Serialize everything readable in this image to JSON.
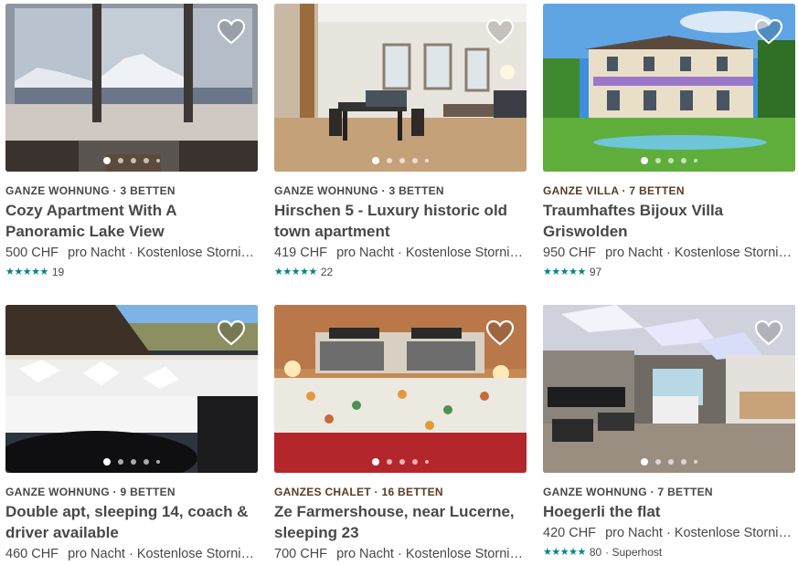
{
  "colors": {
    "text": "#484848",
    "star": "#008489",
    "kicker_brown": "#593c21"
  },
  "listings": [
    {
      "kicker": "GANZE WOHNUNG · 3 BETTEN",
      "title": "Cozy Apartment With A Panoramic Lake View",
      "price": "500 CHF",
      "per_night": "pro Nacht",
      "extra": "· Kostenlose Stornierung",
      "stars": "★★★★★",
      "reviews": "19",
      "superhost": "",
      "icon": "heart-icon"
    },
    {
      "kicker": "GANZE WOHNUNG · 3 BETTEN",
      "title": "Hirschen 5 - Luxury historic old town apartment",
      "price": "419 CHF",
      "per_night": "pro Nacht",
      "extra": "· Kostenlose Stornierung",
      "stars": "★★★★★",
      "reviews": "22",
      "superhost": "",
      "icon": "heart-icon"
    },
    {
      "kicker": "GANZE VILLA · 7 BETTEN",
      "title": "Traumhaftes Bijoux Villa Griswolden",
      "price": "950 CHF",
      "per_night": "pro Nacht",
      "extra": "· Kostenlose Stornierung",
      "stars": "★★★★★",
      "reviews": "97",
      "superhost": "",
      "icon": "heart-icon"
    },
    {
      "kicker": "GANZE WOHNUNG · 9 BETTEN",
      "title": "Double apt, sleeping 14, coach & driver available",
      "price": "460 CHF",
      "per_night": "pro Nacht",
      "extra": "· Kostenlose Stornierung",
      "stars": "",
      "reviews": "",
      "superhost": "",
      "icon": "heart-icon"
    },
    {
      "kicker": "GANZES CHALET · 16 BETTEN",
      "title": "Ze Farmershouse, near Lucerne, sleeping 23",
      "price": "700 CHF",
      "per_night": "pro Nacht",
      "extra": "· Kostenlose Stornierung",
      "stars": "",
      "reviews": "",
      "superhost": "",
      "icon": "heart-icon"
    },
    {
      "kicker": "GANZE WOHNUNG · 7 BETTEN",
      "title": "Hoegerli the flat",
      "price": "420 CHF",
      "per_night": "pro Nacht",
      "extra": "· Kostenlose Stornierung",
      "stars": "★★★★★",
      "reviews": "80",
      "superhost": "· Superhost",
      "icon": "heart-icon"
    }
  ]
}
